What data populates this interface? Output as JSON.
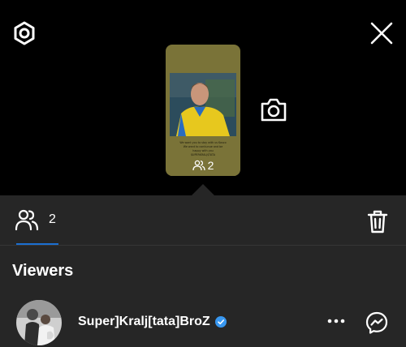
{
  "story": {
    "viewer_count": "2",
    "caption_lines": [
      "We want you to stay with us Kosco",
      "We want to contiunue and be",
      "happy with you",
      "$UPERKRALJ$TATA"
    ]
  },
  "tabs": {
    "viewers_count": "2"
  },
  "section": {
    "title": "Viewers"
  },
  "viewers": [
    {
      "name": "Super]Kralj[tata]BroZ",
      "verified": true
    }
  ],
  "colors": {
    "background_top": "#000000",
    "sheet": "#262626",
    "accent": "#1b6fd1",
    "story_card": "#7a7338",
    "verified_badge": "#3897f0"
  },
  "icons": {
    "settings": "gear-icon",
    "close": "close-icon",
    "camera": "camera-icon",
    "viewers": "people-icon",
    "delete": "trash-icon",
    "more": "more-dots-icon",
    "message": "messenger-icon"
  }
}
